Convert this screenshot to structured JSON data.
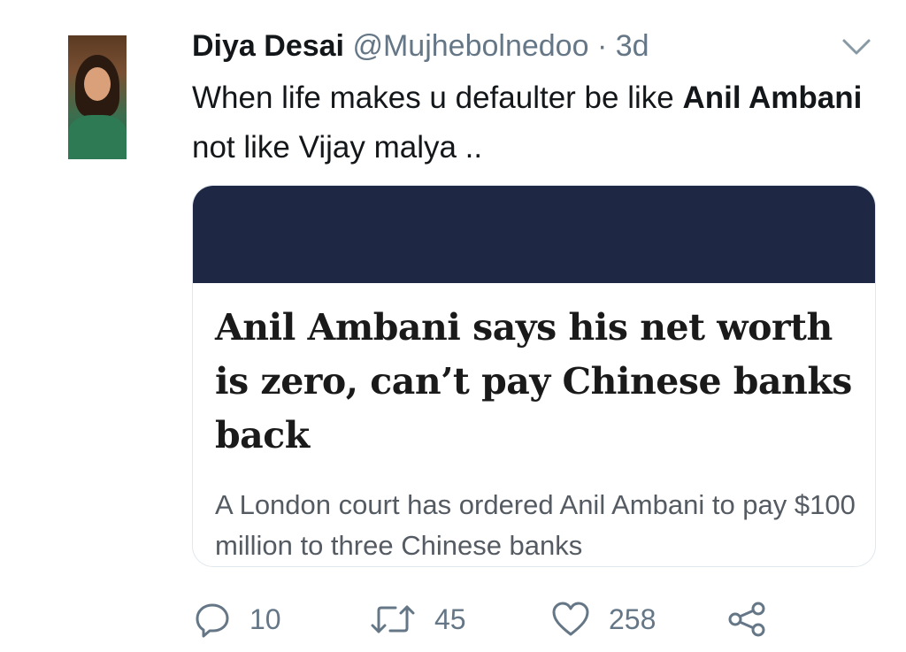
{
  "tweet": {
    "name": "Diya Desai",
    "handle": "@Mujhebolnedoo",
    "separator": "·",
    "time": "3d",
    "text_part1": "When life makes u defaulter be like ",
    "text_bold1": "Anil Ambani",
    "text_part2": " not like Vijay malya .."
  },
  "card": {
    "image_color": "#1e2743",
    "title": "Anil Ambani says his net worth is zero, can’t pay Chinese banks back",
    "description": "A London court has ordered Anil Ambani to pay $100 million to three Chinese banks"
  },
  "actions": {
    "reply_icon": "reply-icon",
    "reply_count": "10",
    "retweet_icon": "retweet-icon",
    "retweet_count": "45",
    "like_icon": "heart-icon",
    "like_count": "258",
    "share_icon": "share-icon"
  },
  "colors": {
    "text": "#14171a",
    "secondary": "#657786",
    "border": "#e1e8ed"
  }
}
